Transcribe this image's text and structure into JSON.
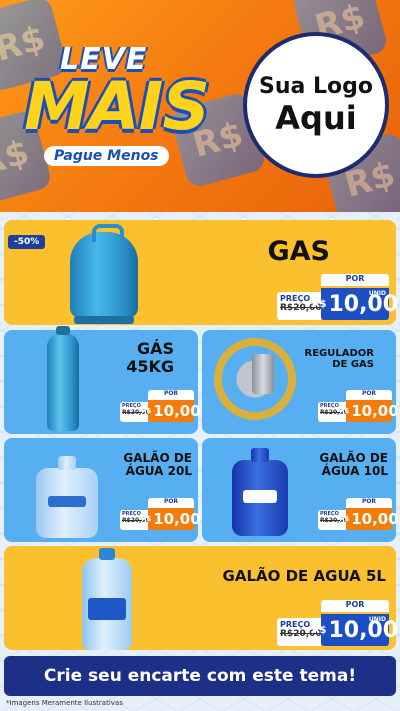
{
  "header": {
    "brand_leve": "LEVE",
    "brand_mais": "MAIS",
    "brand_pague": "Pague Menos",
    "logo_line1": "Sua Logo",
    "logo_line2": "Aqui",
    "tile_text": "R$"
  },
  "discount_badge": "-50%",
  "price_labels": {
    "preco": "PREÇO",
    "por": "POR",
    "unid": "UNID",
    "currency": "R$"
  },
  "products": [
    {
      "name": "GAS",
      "old_price": "R$20,00",
      "new_price": "10,00"
    },
    {
      "name_line1": "GÁS",
      "name_line2": "45KG",
      "old_price": "R$20,00",
      "new_price": "10,00"
    },
    {
      "name_line1": "REGULADOR",
      "name_line2": "DE GAS",
      "old_price": "R$20,00",
      "new_price": "10,00"
    },
    {
      "name_line1": "GALÃO DE",
      "name_line2": "ÁGUA 20L",
      "old_price": "R$20,00",
      "new_price": "10,00"
    },
    {
      "name_line1": "GALÃO DE",
      "name_line2": "ÁGUA 10L",
      "old_price": "R$20,00",
      "new_price": "10,00"
    },
    {
      "name": "GALÃO DE AGUA 5L",
      "old_price": "R$20,00",
      "new_price": "10,00"
    }
  ],
  "cta": "Crie seu encarte com este tema!",
  "footnote": "*Imagens Meramente Ilustrativas",
  "colors": {
    "yellow": "#fbc02d",
    "blue": "#57aef0",
    "navy": "#1d2f86",
    "orange": "#f57c0a"
  }
}
